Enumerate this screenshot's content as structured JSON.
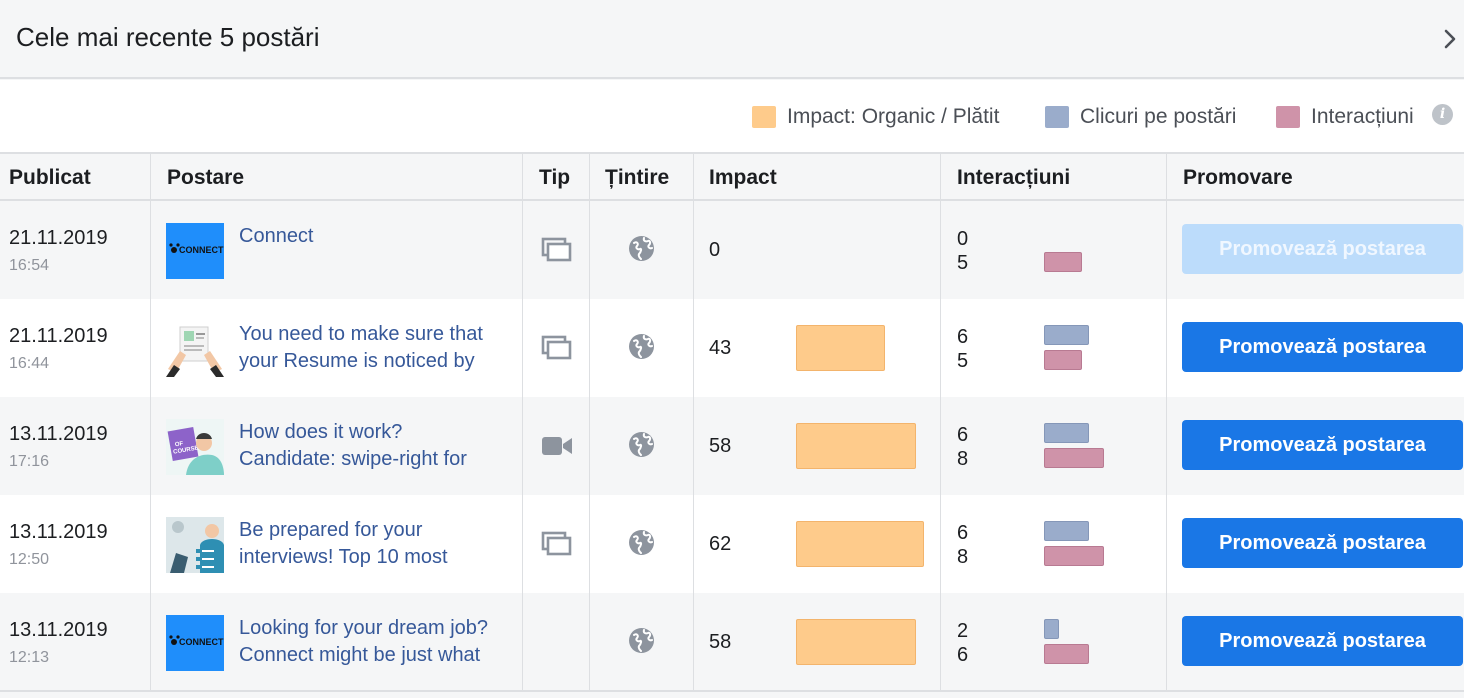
{
  "header": {
    "title": "Cele mai recente 5 postări",
    "chevron_icon": "chevron-right-icon"
  },
  "legend": {
    "items": [
      {
        "label": "Impact: Organic / Plătit",
        "color": "#fecb8b"
      },
      {
        "label": "Clicuri pe postări",
        "color": "#9aaccb"
      },
      {
        "label": "Interacțiuni",
        "color": "#cf93a9"
      }
    ],
    "info_icon": "info-icon"
  },
  "columns": [
    "Publicat",
    "Postare",
    "Tip",
    "Țintire",
    "Impact",
    "Interacțiuni",
    "Promovare"
  ],
  "colors": {
    "link": "#365899",
    "button": "#1a77e6",
    "button_disabled": "#bcdcfb",
    "impact_bar": "#fecb8b",
    "clicks_bar": "#9aaccb",
    "interactions_bar": "#cf93a9"
  },
  "max_value": 62,
  "rows": [
    {
      "date": "21.11.2019",
      "time": "16:54",
      "text_line1": "Connect",
      "text_line2": "",
      "thumbnail": "connect-logo",
      "type_icon": "album-icon",
      "targeting_icon": "globe-icon",
      "impact": "0",
      "impact_value": 0,
      "clicks": "0",
      "clicks_value": 0,
      "interactions": "5",
      "interactions_value": 5,
      "button": "Promovează postarea",
      "button_disabled": true
    },
    {
      "date": "21.11.2019",
      "time": "16:44",
      "text_line1": "You need to make sure that",
      "text_line2": "your Resume is noticed by",
      "thumbnail": "resume-illustration",
      "type_icon": "album-icon",
      "targeting_icon": "globe-icon",
      "impact": "43",
      "impact_value": 43,
      "clicks": "6",
      "clicks_value": 6,
      "interactions": "5",
      "interactions_value": 5,
      "button": "Promovează postarea",
      "button_disabled": false
    },
    {
      "date": "13.11.2019",
      "time": "17:16",
      "text_line1": "How does it work?",
      "text_line2": "Candidate: swipe-right for",
      "thumbnail": "of-course-illustration",
      "type_icon": "video-camera-icon",
      "targeting_icon": "globe-icon",
      "impact": "58",
      "impact_value": 58,
      "clicks": "6",
      "clicks_value": 6,
      "interactions": "8",
      "interactions_value": 8,
      "button": "Promovează postarea",
      "button_disabled": false
    },
    {
      "date": "13.11.2019",
      "time": "12:50",
      "text_line1": "Be prepared for your",
      "text_line2": "interviews! Top 10 most",
      "thumbnail": "interview-illustration",
      "type_icon": "album-icon",
      "targeting_icon": "globe-icon",
      "impact": "62",
      "impact_value": 62,
      "clicks": "6",
      "clicks_value": 6,
      "interactions": "8",
      "interactions_value": 8,
      "button": "Promovează postarea",
      "button_disabled": false
    },
    {
      "date": "13.11.2019",
      "time": "12:13",
      "text_line1": "Looking for your dream job?",
      "text_line2": "Connect might be just what",
      "thumbnail": "connect-logo",
      "type_icon": "",
      "targeting_icon": "globe-icon",
      "impact": "58",
      "impact_value": 58,
      "clicks": "2",
      "clicks_value": 2,
      "interactions": "6",
      "interactions_value": 6,
      "button": "Promovează postarea",
      "button_disabled": false
    }
  ]
}
